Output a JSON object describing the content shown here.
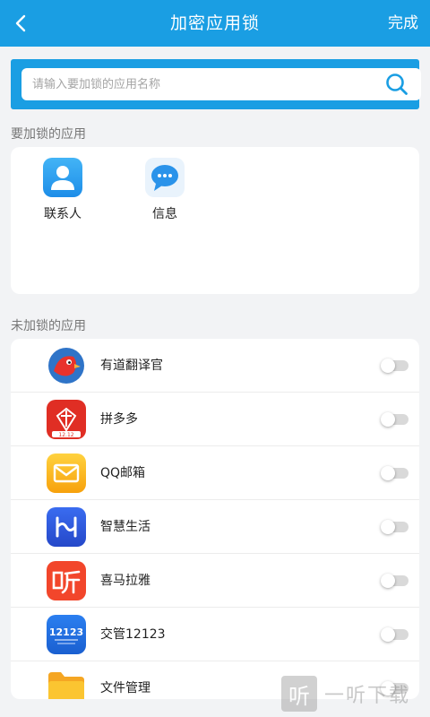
{
  "header": {
    "title": "加密应用锁",
    "done_label": "完成",
    "back_icon": "chevron-left-icon",
    "color": "#1a9ee3"
  },
  "search": {
    "placeholder": "请输入要加锁的应用名称",
    "value": "",
    "icon": "search-icon"
  },
  "locked_section": {
    "title": "要加锁的应用",
    "apps": [
      {
        "name": "联系人",
        "icon": "contacts-icon"
      },
      {
        "name": "信息",
        "icon": "messages-icon"
      }
    ]
  },
  "unlocked_section": {
    "title": "未加锁的应用",
    "apps": [
      {
        "name": "有道翻译官",
        "icon": "youdao-translate-icon",
        "locked": false
      },
      {
        "name": "拼多多",
        "icon": "pinduoduo-icon",
        "locked": false
      },
      {
        "name": "QQ邮箱",
        "icon": "qq-mail-icon",
        "locked": false
      },
      {
        "name": "智慧生活",
        "icon": "smart-life-icon",
        "locked": false
      },
      {
        "name": "喜马拉雅",
        "icon": "ximalaya-icon",
        "locked": false
      },
      {
        "name": "交管12123",
        "icon": "traffic-12123-icon",
        "locked": false
      },
      {
        "name": "文件管理",
        "icon": "file-manager-icon",
        "locked": false
      }
    ]
  },
  "watermark": {
    "logo_char": "听",
    "text": "一听下载"
  }
}
